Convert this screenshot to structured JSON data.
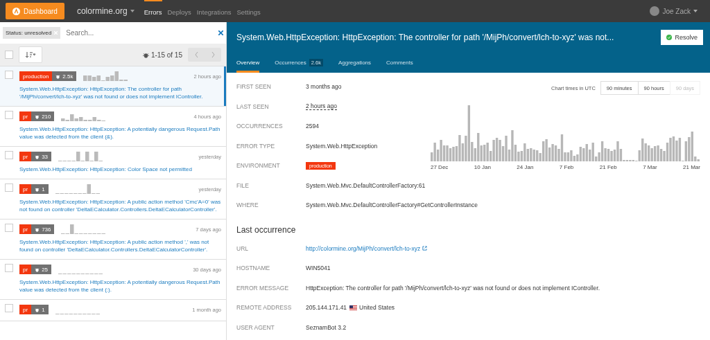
{
  "topbar": {
    "dashboard_button": "Dashboard",
    "project": "colormine.org",
    "nav": [
      {
        "label": "Errors",
        "selected": true
      },
      {
        "label": "Deploys",
        "selected": false
      },
      {
        "label": "Integrations",
        "selected": false
      },
      {
        "label": "Settings",
        "selected": false
      }
    ],
    "user": "Joe Zack"
  },
  "sidebar": {
    "filter_tag": "Status: unresolved",
    "search": {
      "placeholder": "Search..."
    },
    "select_all_checked": false,
    "range": "1-15 of 15",
    "items": [
      {
        "environment": "production",
        "count": "2.5k",
        "time": "2 hours ago",
        "message": "System.Web.HttpException: HttpException: The controller for path '/MijPh/convert/lch-to-xyz' was not found or does not implement IController.",
        "selected": true,
        "checked": false
      },
      {
        "environment": "pr",
        "count": "210",
        "time": "4 hours ago",
        "message": "System.Web.HttpException: HttpException: A potentially dangerous Request.Path value was detected from the client (&).",
        "selected": false,
        "checked": false
      },
      {
        "environment": "pr",
        "count": "33",
        "time": "yesterday",
        "message": "System.Web.HttpException: HttpException: Color Space not permitted",
        "selected": false,
        "checked": false
      },
      {
        "environment": "pr",
        "count": "1",
        "time": "yesterday",
        "message": "System.Web.HttpException: HttpException: A public action method 'Cmc'A=0' was not found on controller 'DeltaECalculator.Controllers.DeltaECalculatorController'.",
        "selected": false,
        "checked": false
      },
      {
        "environment": "pr",
        "count": "736",
        "time": "7 days ago",
        "message": "System.Web.HttpException: HttpException: A public action method ',' was not found on controller 'DeltaECalculator.Controllers.DeltaECalculatorController'.",
        "selected": false,
        "checked": false
      },
      {
        "environment": "pr",
        "count": "25",
        "time": "30 days ago",
        "message": "System.Web.HttpException: HttpException: A potentially dangerous Request.Path value was detected from the client (:).",
        "selected": false,
        "checked": false
      },
      {
        "environment": "pr",
        "count": "1",
        "time": "1 month ago",
        "selected": false,
        "checked": false
      }
    ]
  },
  "detail": {
    "title": "System.Web.HttpException: HttpException: The controller for path '/MijPh/convert/lch-to-xyz' was not...",
    "resolve_button": "Resolve",
    "tabs": [
      {
        "label": "Overview",
        "selected": true
      },
      {
        "label": "Occurrences",
        "badge": "2.6k",
        "selected": false
      },
      {
        "label": "Aggregations",
        "selected": false
      },
      {
        "label": "Comments",
        "selected": false
      }
    ],
    "fields": [
      {
        "label": "FIRST SEEN",
        "value": "3 months ago",
        "kind": "text"
      },
      {
        "label": "LAST SEEN",
        "value": "2 hours ago",
        "kind": "dotted"
      },
      {
        "label": "OCCURRENCES",
        "value": "2594",
        "kind": "text"
      },
      {
        "label": "ERROR TYPE",
        "value": "System.Web.HttpException",
        "kind": "text"
      },
      {
        "label": "ENVIRONMENT",
        "value": "production",
        "kind": "tag"
      },
      {
        "label": "FILE",
        "value": "System.Web.Mvc.DefaultControllerFactory:61",
        "kind": "text"
      },
      {
        "label": "WHERE",
        "value": "System.Web.Mvc.DefaultControllerFactory#GetControllerInstance",
        "kind": "text"
      }
    ],
    "chart": {
      "timezone_note": "Chart times in UTC",
      "ranges": [
        {
          "label": "90 minutes",
          "selected": false
        },
        {
          "label": "90 hours",
          "selected": false
        },
        {
          "label": "90 days",
          "selected": true
        }
      ],
      "x_labels": [
        "27 Dec",
        "10 Jan",
        "24 Jan",
        "7 Feb",
        "21 Feb",
        "7 Mar",
        "21 Mar"
      ]
    },
    "last_occurrence": {
      "heading": "Last occurrence",
      "fields": [
        {
          "label": "URL",
          "value": "http://colormine.org/MijPh/convert/lch-to-xyz",
          "kind": "link"
        },
        {
          "label": "HOSTNAME",
          "value": "WIN5041",
          "kind": "text"
        },
        {
          "label": "ERROR MESSAGE",
          "value": "HttpException: The controller for path '/MijPh/convert/lch-to-xyz' was not found or does not implement IController.",
          "kind": "text"
        },
        {
          "label": "REMOTE ADDRESS",
          "value": "205.144.171.41",
          "country": "United States",
          "kind": "country"
        },
        {
          "label": "USER AGENT",
          "value": "SeznamBot 3.2",
          "kind": "text"
        }
      ]
    }
  }
}
